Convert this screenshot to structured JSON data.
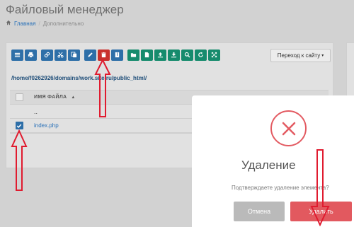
{
  "page": {
    "title": "Файловый менеджер"
  },
  "breadcrumb": {
    "home": "Главная",
    "current": "Дополнительно"
  },
  "toolbar": {
    "buttons": [
      {
        "icon": "list-icon",
        "color": "#2e6fa8"
      },
      {
        "icon": "print-icon",
        "color": "#2e6fa8"
      },
      {
        "icon": "link-icon",
        "color": "#2e6fa8"
      },
      {
        "icon": "cut-icon",
        "color": "#2e6fa8"
      },
      {
        "icon": "copy-icon",
        "color": "#2e6fa8"
      },
      {
        "icon": "pencil-icon",
        "color": "#2e6fa8"
      },
      {
        "icon": "trash-icon",
        "color": "#c9302c"
      },
      {
        "icon": "archive-icon",
        "color": "#2e6fa8"
      },
      {
        "icon": "folder-icon",
        "color": "#168b6d"
      },
      {
        "icon": "new-file-icon",
        "color": "#168b6d"
      },
      {
        "icon": "upload-icon",
        "color": "#168b6d"
      },
      {
        "icon": "download-icon",
        "color": "#168b6d"
      },
      {
        "icon": "search-icon",
        "color": "#168b6d"
      },
      {
        "icon": "refresh-icon",
        "color": "#168b6d"
      },
      {
        "icon": "expand-icon",
        "color": "#168b6d"
      }
    ],
    "goto_label": "Переход к сайту"
  },
  "path": "/home/f0262926/domains/work.site.ru/public_html/",
  "table": {
    "header": "ИМЯ ФАЙЛА",
    "parent": "..",
    "files": [
      {
        "name": "index.php",
        "checked": true
      }
    ]
  },
  "modal": {
    "title": "Удаление",
    "text": "Подтверждаете удаление элемента?",
    "cancel": "Отмена",
    "confirm": "Удалить",
    "accent": "#e2595f"
  }
}
